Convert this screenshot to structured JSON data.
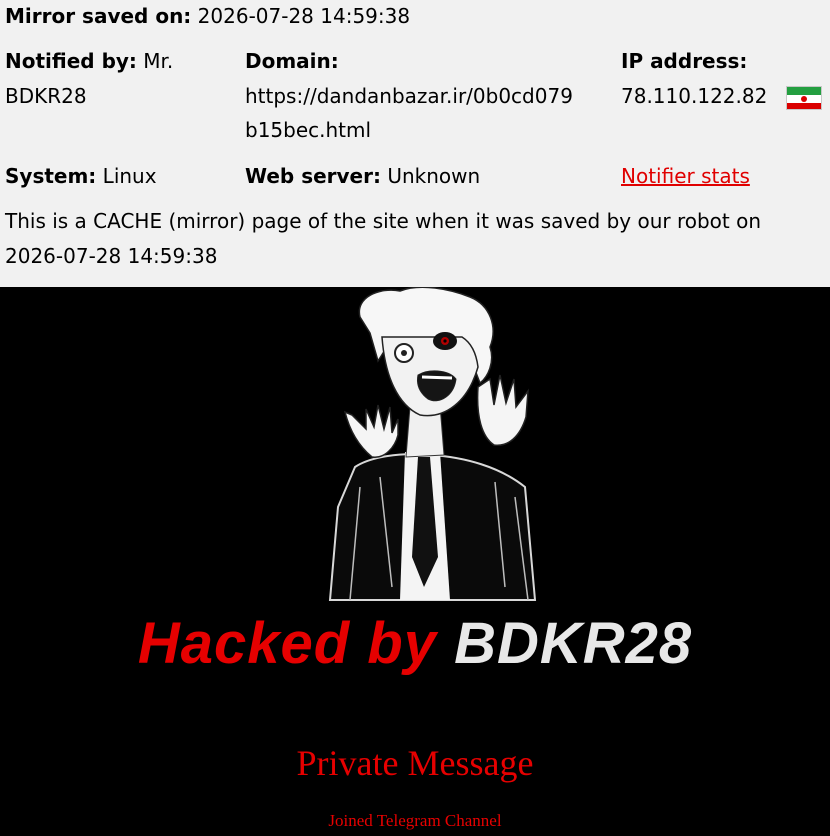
{
  "mirror": {
    "label": "Mirror saved on:",
    "value": "2026-07-28 14:59:38"
  },
  "notified": {
    "label": "Notified by:",
    "value_line1": "Mr.",
    "value_line2": "BDKR28"
  },
  "domain": {
    "label": "Domain:",
    "value_line1": "https://dandanbazar.ir/0b0cd079",
    "value_line2": "b15bec.html"
  },
  "ip": {
    "label": "IP address:",
    "value": "78.110.122.82",
    "flag_icon": "iran-flag-icon"
  },
  "system": {
    "label": "System:",
    "value": "Linux"
  },
  "webserver": {
    "label": "Web server:",
    "value": "Unknown"
  },
  "notifier_stats": {
    "label": "Notifier stats"
  },
  "cache_note": {
    "line1": "This is a CACHE (mirror) page of the site when it was saved by our robot on",
    "line2": "2026-07-28 14:59:38"
  },
  "deface": {
    "hacked_red": "Hacked by",
    "hacked_white": "BDKR28",
    "private_message": "Private Message",
    "telegram": "Joined Telegram Channel"
  },
  "colors": {
    "accent_red": "#e60000",
    "header_bg": "#f1f1f1",
    "page_bg": "#000000"
  }
}
